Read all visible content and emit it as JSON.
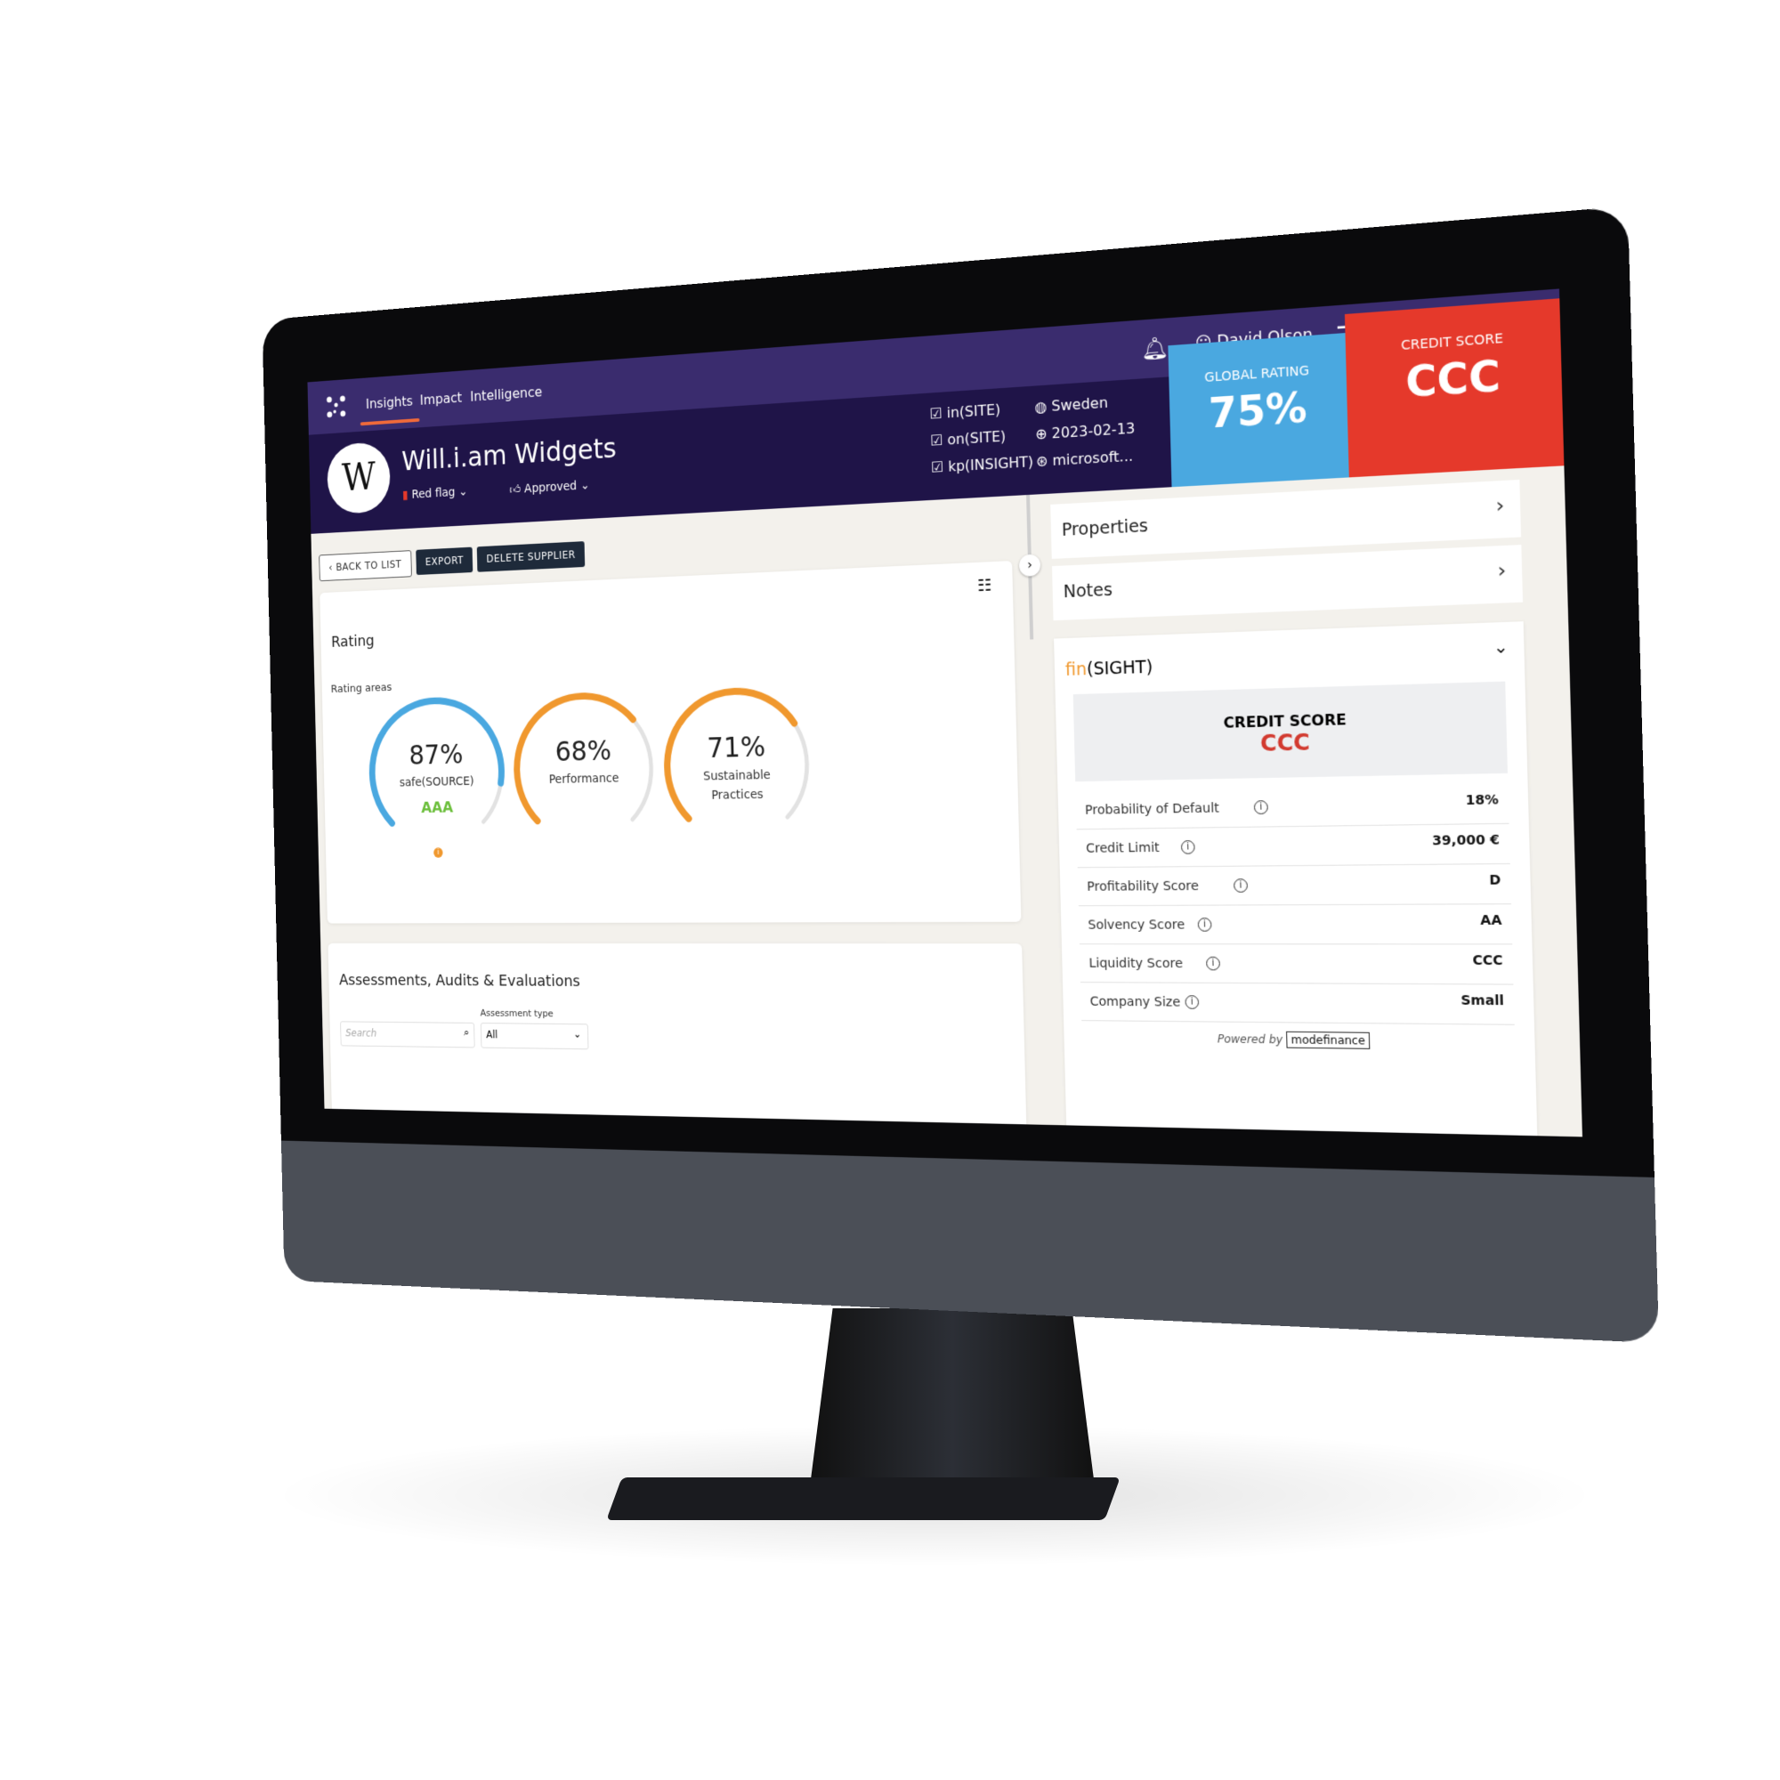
{
  "nav": {
    "tabs": [
      {
        "label": "Insights",
        "active": true
      },
      {
        "label": "Impact"
      },
      {
        "label": "Intelligence"
      }
    ],
    "user": "David Olson",
    "icons": [
      "bell-icon",
      "user-icon",
      "menu-icon",
      "help-icon",
      "collapse-icon"
    ]
  },
  "supplier": {
    "avatar_letter": "W",
    "name": "Will.i.am Widgets",
    "flag": "Red flag",
    "status": "Approved",
    "checks": [
      "in(SITE)",
      "on(SITE)",
      "kp(INSIGHT)"
    ],
    "country": "Sweden",
    "date": "2023-02-13",
    "website": "microsoft..."
  },
  "global_rating": {
    "label": "GLOBAL RATING",
    "value": "75%",
    "color": "#4aa8e0"
  },
  "credit_score_box": {
    "label": "CREDIT SCORE",
    "value": "CCC",
    "color": "#e5392b"
  },
  "actions": {
    "back": "BACK TO LIST",
    "export": "EXPORT",
    "delete": "DELETE SUPPLIER"
  },
  "rating": {
    "title": "Rating",
    "subtitle": "Rating areas",
    "gauges": [
      {
        "value": "87%",
        "fraction": 0.87,
        "label": "safe(SOURCE)",
        "grade": "AAA",
        "color": "#4aa8e0"
      },
      {
        "value": "68%",
        "fraction": 0.68,
        "label": "Performance",
        "color": "#f0982e"
      },
      {
        "value": "71%",
        "fraction": 0.71,
        "label": "Sustainable",
        "label2": "Practices",
        "color": "#f0982e"
      }
    ]
  },
  "assessments": {
    "title": "Assessments, Audits & Evaluations",
    "search_placeholder": "Search",
    "type_label": "Assessment type",
    "type_value": "All"
  },
  "panels": {
    "properties": "Properties",
    "notes": "Notes"
  },
  "finsight": {
    "brand_a": "fin",
    "brand_b": "(SIGHT)",
    "credit_label": "CREDIT SCORE",
    "credit_value": "CCC",
    "rows": [
      {
        "label": "Probability of Default",
        "value": "18%"
      },
      {
        "label": "Credit Limit",
        "value": "39,000 €"
      },
      {
        "label": "Profitability Score",
        "value": "D"
      },
      {
        "label": "Solvency Score",
        "value": "AA"
      },
      {
        "label": "Liquidity Score",
        "value": "CCC"
      },
      {
        "label": "Company Size",
        "value": "Small"
      }
    ],
    "powered_by": "Powered by",
    "provider": "modefinance"
  }
}
